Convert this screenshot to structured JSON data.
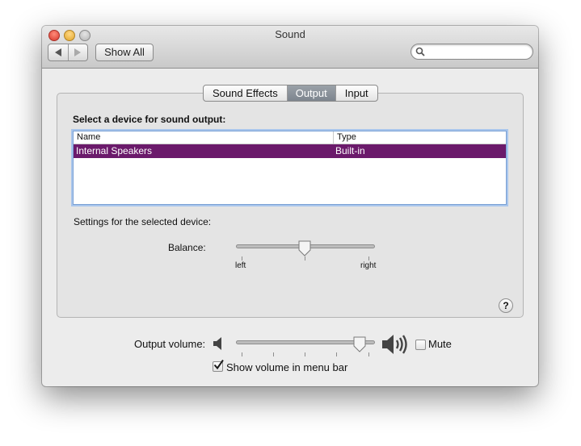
{
  "window": {
    "title": "Sound"
  },
  "toolbar": {
    "back_icon": "back-arrow-icon",
    "forward_icon": "forward-arrow-icon",
    "show_all_label": "Show All",
    "search_placeholder": ""
  },
  "tabs": [
    {
      "label": "Sound Effects",
      "active": false
    },
    {
      "label": "Output",
      "active": true
    },
    {
      "label": "Input",
      "active": false
    }
  ],
  "output": {
    "heading": "Select a device for sound output:",
    "columns": [
      "Name",
      "Type"
    ],
    "devices": [
      {
        "name": "Internal Speakers",
        "type": "Built-in",
        "selected": true
      }
    ],
    "settings_label": "Settings for the selected device:",
    "balance_label": "Balance:",
    "balance_left": "left",
    "balance_right": "right",
    "balance_value": 0.5
  },
  "volume": {
    "label": "Output volume:",
    "value": 0.9,
    "mute_label": "Mute",
    "muted": false,
    "menu_bar_label": "Show volume in menu bar",
    "menu_bar_checked": true
  },
  "colors": {
    "selection": "#6b1a6b",
    "tab_active": "#858c94",
    "focus_ring": "#7aa0d4"
  }
}
